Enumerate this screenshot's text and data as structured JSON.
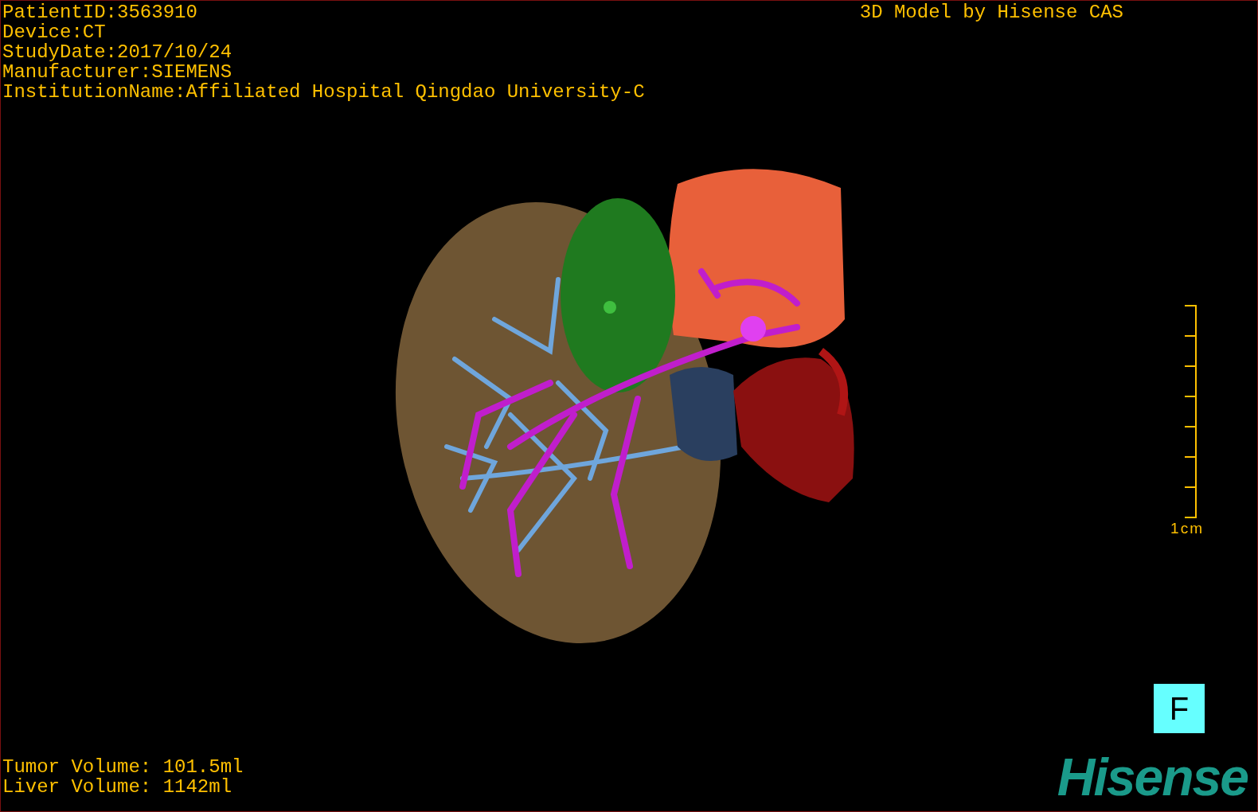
{
  "study_info": [
    "PatientID:3563910",
    "Device:CT",
    "StudyDate:2017/10/24",
    "Manufacturer:SIEMENS",
    "InstitutionName:Affiliated Hospital Qingdao University-C"
  ],
  "caption": "3D Model by Hisense CAS",
  "scale_bar": {
    "label": "1cm"
  },
  "orientation_marker": "F",
  "volumes": [
    "Tumor Volume: 101.5ml",
    "Liver Volume: 1142ml"
  ],
  "logo": "Hisense"
}
